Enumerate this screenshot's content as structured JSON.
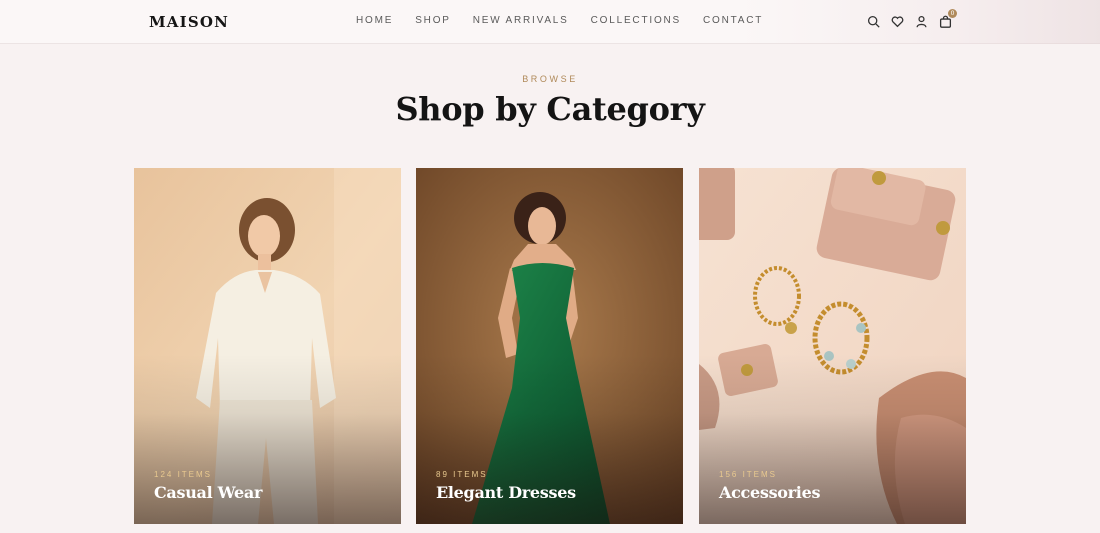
{
  "brand": {
    "logo": "MAISON"
  },
  "nav": {
    "items": [
      {
        "label": "HOME"
      },
      {
        "label": "SHOP"
      },
      {
        "label": "NEW ARRIVALS"
      },
      {
        "label": "COLLECTIONS"
      },
      {
        "label": "CONTACT"
      }
    ]
  },
  "header_icons": {
    "search": "search-icon",
    "wishlist": "heart-icon",
    "account": "user-icon",
    "cart": "shopping-bag-icon",
    "cart_count": "0"
  },
  "section": {
    "eyebrow": "BROWSE",
    "title": "Shop by Category"
  },
  "categories": [
    {
      "count": "124 ITEMS",
      "name": "Casual Wear"
    },
    {
      "count": "89 ITEMS",
      "name": "Elegant Dresses"
    },
    {
      "count": "156 ITEMS",
      "name": "Accessories"
    }
  ],
  "colors": {
    "background": "#f8f2f2",
    "accent": "#b08a5a",
    "count_label": "#e9c98f",
    "heading": "#141414"
  }
}
